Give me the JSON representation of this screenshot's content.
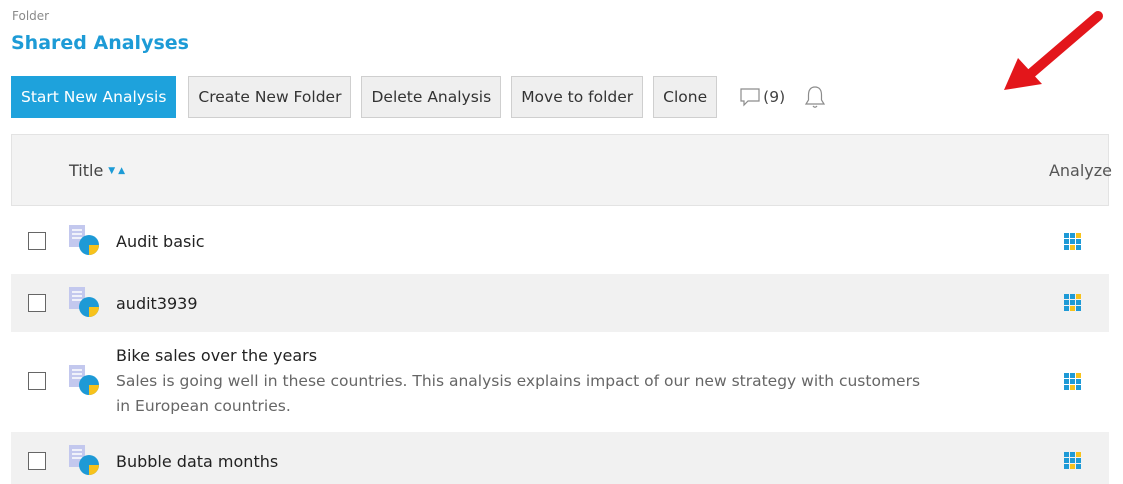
{
  "header": {
    "folder_label": "Folder",
    "title": "Shared Analyses"
  },
  "toolbar": {
    "start_new_analysis": "Start New Analysis",
    "create_new_folder": "Create New Folder",
    "delete_analysis": "Delete Analysis",
    "move_to_folder": "Move to folder",
    "clone": "Clone",
    "comments_count": "(9)"
  },
  "grid": {
    "title_header": "Title",
    "analyze_header": "Analyze",
    "rows": [
      {
        "title": "Audit basic",
        "description": ""
      },
      {
        "title": "audit3939",
        "description": ""
      },
      {
        "title": "Bike sales over the years",
        "description": "Sales is going well in these countries. This analysis explains impact of our new strategy with customers in European countries."
      },
      {
        "title": "Bubble data months",
        "description": ""
      }
    ]
  },
  "icons": [
    "comment-icon",
    "bell-icon",
    "red-arrow-icon",
    "analysis-document-icon",
    "analyze-grid-icon",
    "sort-icon"
  ],
  "colors": {
    "accent": "#1ea2dc",
    "title": "#1d9bd6",
    "arrow": "#e3161b",
    "alt_row": "#f1f1f1"
  }
}
